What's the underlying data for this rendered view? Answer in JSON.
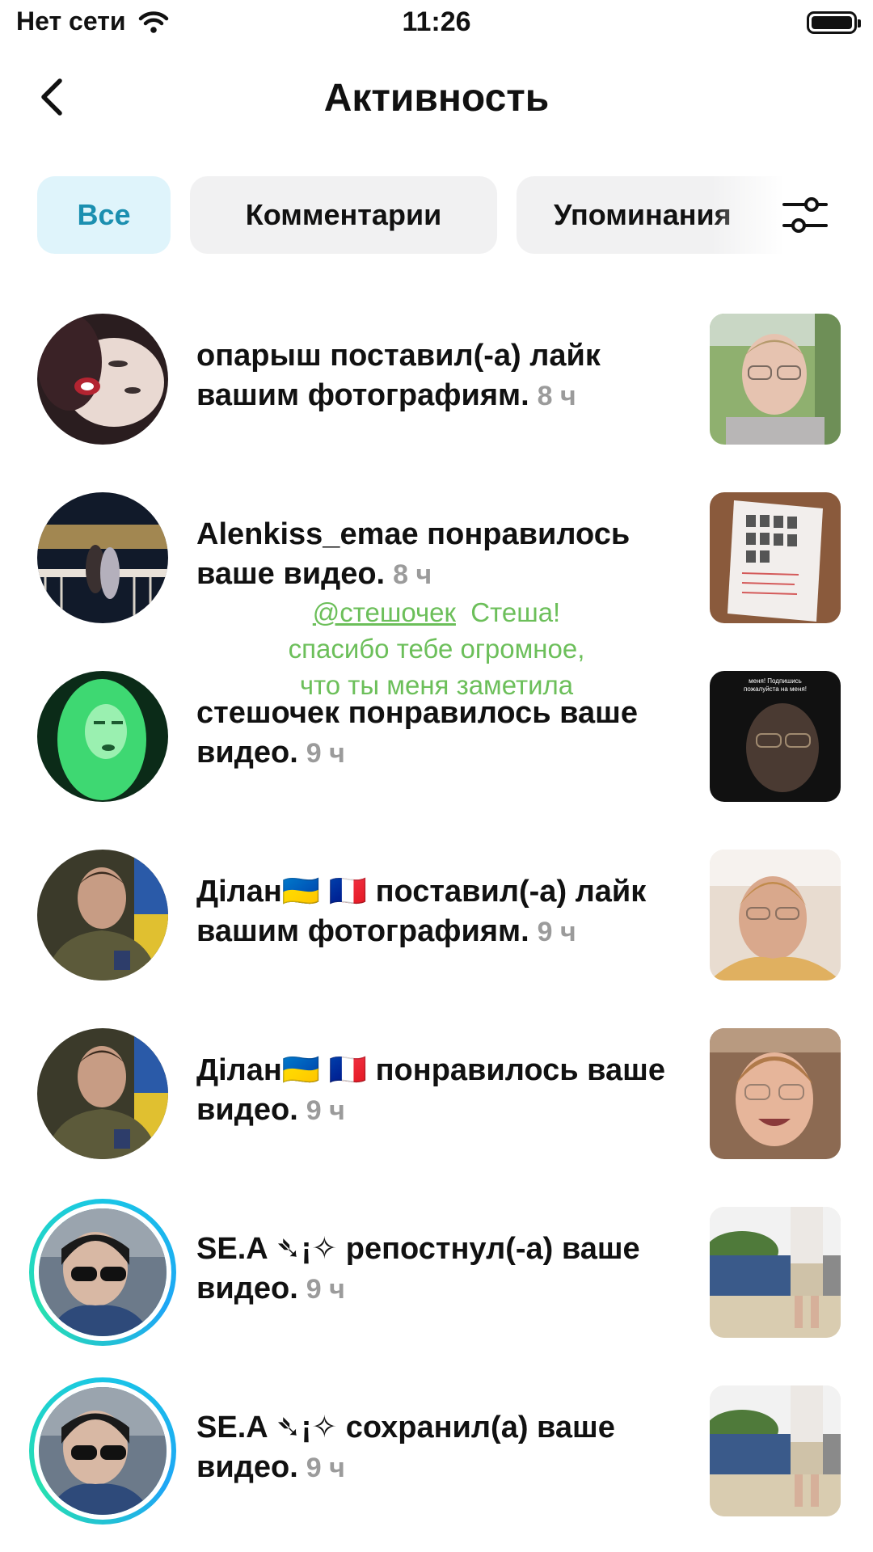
{
  "status_bar": {
    "carrier": "Нет сети",
    "time": "11:26",
    "wifi_icon": "wifi-icon",
    "battery_icon": "battery-icon"
  },
  "header": {
    "title": "Активность",
    "back_icon": "chevron-left-icon"
  },
  "filters": {
    "chips": [
      {
        "label": "Все",
        "active": true
      },
      {
        "label": "Комментарии",
        "active": false
      },
      {
        "label": "Упоминания",
        "active": false
      }
    ],
    "settings_icon": "sliders-icon"
  },
  "overlay_caption": {
    "mention": "@стешочек",
    "line1": "Стеша!",
    "line2": "спасибо тебе огромное,",
    "line3": "что ты меня заметила"
  },
  "activities": [
    {
      "text": "опарыш поставил(-а) лайк вашим фотографиям.",
      "time": "8 ч"
    },
    {
      "text": "Alenkiss_emae понравилось ваше видео.",
      "time": "8 ч"
    },
    {
      "text": "стешочек понравилось ваше видео.",
      "time": "9 ч"
    },
    {
      "text": "Ділан🇺🇦 🇫🇷 поставил(-а) лайк вашим фотографиям.",
      "time": "9 ч"
    },
    {
      "text": "Ділан🇺🇦 🇫🇷 понравилось ваше видео.",
      "time": "9 ч"
    },
    {
      "text": "SE.A ➴¡✧ репостнул(-а) ваше видео.",
      "time": "9 ч"
    },
    {
      "text": "SE.A ➴¡✧ сохранил(а) ваше видео.",
      "time": "9 ч"
    }
  ],
  "thumb3_caption": "меня! Подпишись пожалуйста на меня!"
}
